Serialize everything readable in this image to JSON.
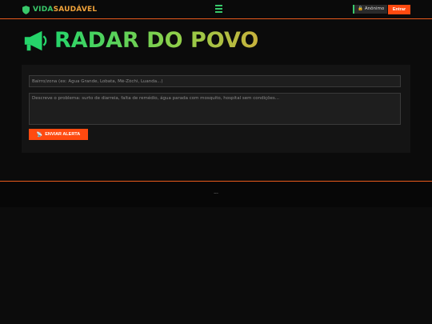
{
  "header": {
    "brand_vida": "VIDA",
    "brand_saudavel": "SAUDÁVEL",
    "anon_label": "Anônimo",
    "login_label": "Entrar"
  },
  "hero": {
    "title": "RADAR DO POVO"
  },
  "form": {
    "neighborhood_placeholder": "Bairro/zona (ex: Água Grande, Lobata, Mé-Zóchi, Luanda...)",
    "problem_placeholder": "Descreve o problema: surto de diarreia, falta de remédio, água parada com mosquito, hospital sem condições...",
    "submit_label": "ENVIAR ALERTA"
  },
  "footer": {
    "text": "..."
  },
  "colors": {
    "accent_green": "#38c86a",
    "accent_orange": "#ff4a10",
    "border_orange": "#e85a1c"
  },
  "icons": {
    "brand": "shield-icon",
    "menu": "menu-icon",
    "anon": "lock-icon",
    "title": "megaphone-icon",
    "submit": "antenna-icon"
  }
}
